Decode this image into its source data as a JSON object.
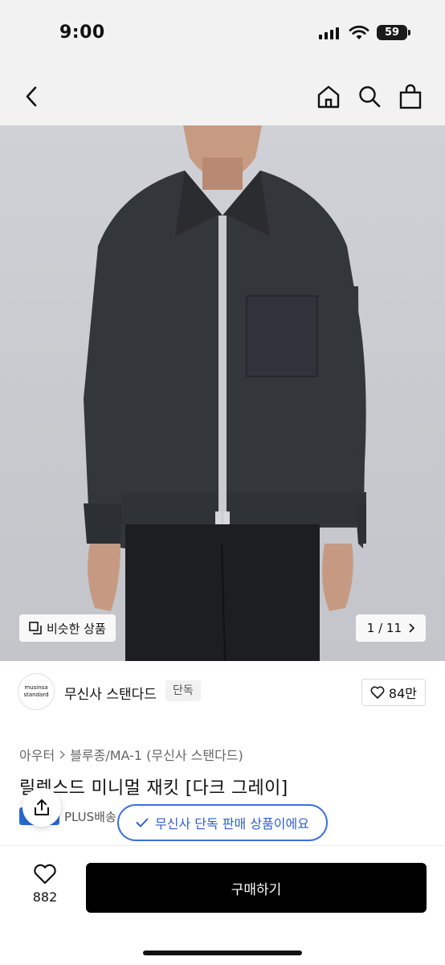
{
  "status_bar": {
    "time": "9:00",
    "battery": "59"
  },
  "nav": {
    "back_icon": "chevron-left-icon",
    "home_icon": "home-icon",
    "search_icon": "search-icon",
    "cart_icon": "shopping-bag-icon"
  },
  "hero": {
    "similar_label": "비슷한 상품",
    "pager": "1 / 11"
  },
  "brand": {
    "logo_line1": "musinsa",
    "logo_line2": "standard",
    "name": "무신사 스탠다드",
    "tag": "단독",
    "likes": "84만"
  },
  "breadcrumb": {
    "category": "아우터",
    "subcategory": "블루종/MA-1 (무신사 스탠다드)"
  },
  "product": {
    "title": "릴렉스드 미니멀 재킷 [다크 그레이]"
  },
  "shipping": {
    "label": "PLUS배송"
  },
  "toast": {
    "message": "무신사 단독 판매 상품이에요"
  },
  "bottom_bar": {
    "wish_count": "882",
    "buy_label": "구매하기"
  },
  "colors": {
    "accent": "#2f5fd0",
    "buy_button": "#000000",
    "jacket": "#33363b"
  }
}
